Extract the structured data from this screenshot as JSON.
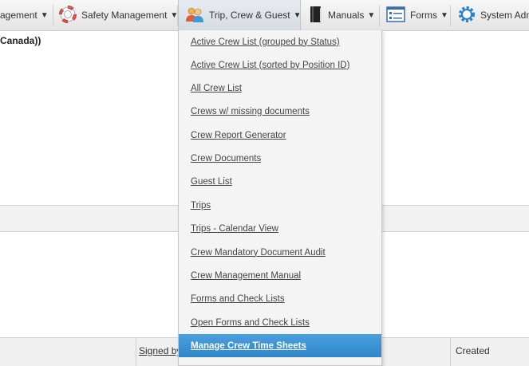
{
  "menubar": {
    "items": [
      {
        "label": "agement"
      },
      {
        "label": "Safety Management"
      },
      {
        "label": "Trip, Crew & Guest"
      },
      {
        "label": "Manuals"
      },
      {
        "label": "Forms"
      },
      {
        "label": "System Adm"
      }
    ],
    "caret": "▼"
  },
  "page": {
    "location_text": "Canada))",
    "table_headers": {
      "signed_by": "Signed by",
      "created": "Created"
    }
  },
  "dropdown": {
    "items": [
      "Active Crew List (grouped by Status)",
      "Active Crew List (sorted by Position ID)",
      "All Crew List",
      "Crews w/ missing documents",
      "Crew Report Generator",
      "Crew Documents",
      "Guest List",
      "Trips",
      "Trips - Calendar View",
      "Crew Mandatory Document Audit",
      "Crew Management Manual",
      "Forms and Check Lists",
      "Open Forms and Check Lists",
      "Manage Crew Time Sheets"
    ],
    "highlighted_index": 13
  },
  "colors": {
    "highlight": "#2f86c9",
    "menubar": "#e4e4e4"
  }
}
